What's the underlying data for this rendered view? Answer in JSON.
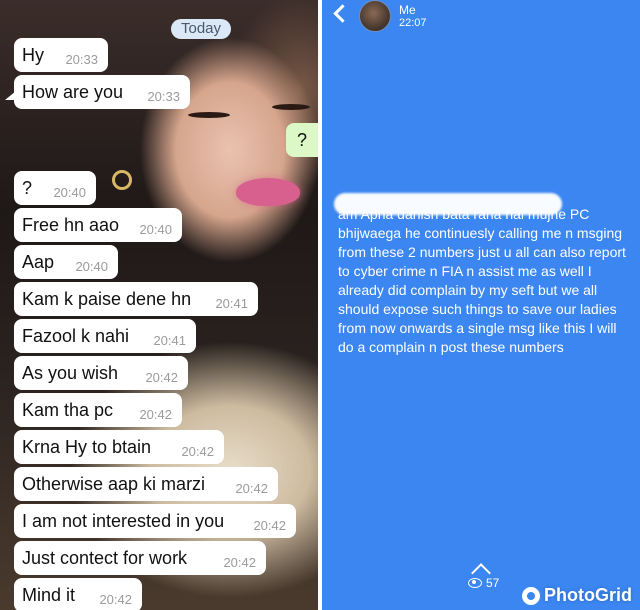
{
  "chat": {
    "date_label": "Today",
    "tail_marker": "",
    "outgoing": "?",
    "messages": [
      {
        "text": "Hy",
        "time": "20:33"
      },
      {
        "text": "How are you",
        "time": "20:33"
      },
      {
        "text": "?",
        "time": "20:40"
      },
      {
        "text": "Free hn aao",
        "time": "20:40"
      },
      {
        "text": "Aap",
        "time": "20:40"
      },
      {
        "text": "Kam k paise dene hn",
        "time": "20:41"
      },
      {
        "text": "Fazool k nahi",
        "time": "20:41"
      },
      {
        "text": "As you wish",
        "time": "20:42"
      },
      {
        "text": "Kam tha pc",
        "time": "20:42"
      },
      {
        "text": "Krna Hy to btain",
        "time": "20:42"
      },
      {
        "text": "Otherwise aap ki marzi",
        "time": "20:42"
      },
      {
        "text": "I am not interested in you",
        "time": "20:42"
      },
      {
        "text": "Just contect for work",
        "time": "20:42"
      },
      {
        "text": "Mind it",
        "time": "20:42"
      }
    ]
  },
  "story": {
    "sender": "Me",
    "time": "22:07",
    "text": "am Apna danish bata raha hai mujhe PC bhijwaega he continuesly calling me n msging from these 2 numbers just u all can also report to cyber crime n FIA n assist me as well I already did complain by my seft but we all should expose such things to save our ladies from now onwards a single msg like this I will do a complain n post these numbers",
    "views": "57",
    "watermark": "PhotoGrid"
  }
}
